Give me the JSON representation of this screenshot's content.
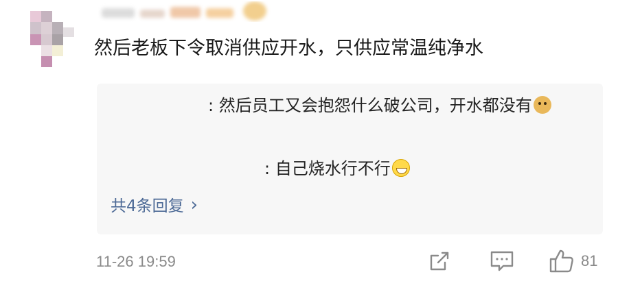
{
  "comment": {
    "text": "然后老板下令取消供应开水，只供应常温纯净水",
    "timestamp": "11-26 19:59",
    "like_count": "81"
  },
  "replies": [
    {
      "text": ": 然后员工又会抱怨什么破公司，开水都没有",
      "emoji": "doge-icon"
    },
    {
      "text": ": 自己烧水行不行",
      "emoji": "grin-icon"
    }
  ],
  "more_replies_label": "共4条回复",
  "colors": {
    "link": "#4d6a96",
    "meta": "#8a8a8a",
    "reply_bg": "#f7f7f7",
    "text": "#1a1a1a"
  },
  "icons": {
    "share": "share-icon",
    "comment": "comment-icon",
    "like": "thumb-up-icon",
    "more": "chevron-right-icon"
  }
}
